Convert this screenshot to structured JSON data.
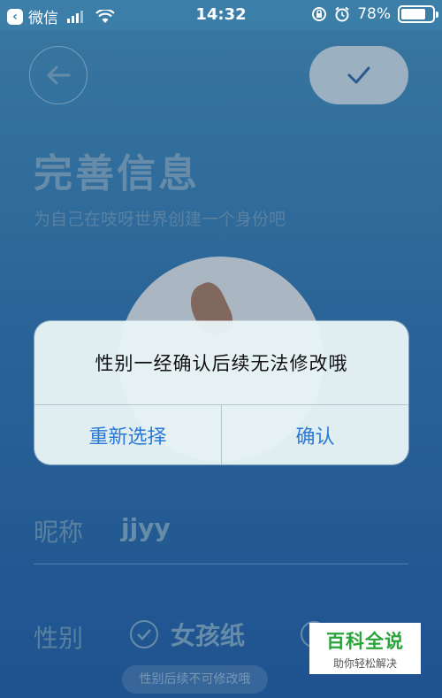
{
  "status_bar": {
    "carrier": "微信",
    "time": "14:32",
    "battery": "78%",
    "battery_level": 0.78
  },
  "page": {
    "title": "完善信息",
    "subtitle": "为自己在吱呀世界创建一个身份吧",
    "nickname_label": "昵称",
    "nickname_value": "jjyy",
    "gender_label": "性别",
    "gender_selected": "女孩纸",
    "gender_hint": "性别后续不可修改哦"
  },
  "dialog": {
    "message": "性别一经确认后续无法修改哦",
    "reselect_label": "重新选择",
    "confirm_label": "确认"
  },
  "watermark": {
    "main": "百科全说",
    "sub": "助你轻松解决"
  },
  "colors": {
    "accent": "#2a79d4",
    "watermark_green": "#2aa33a"
  }
}
